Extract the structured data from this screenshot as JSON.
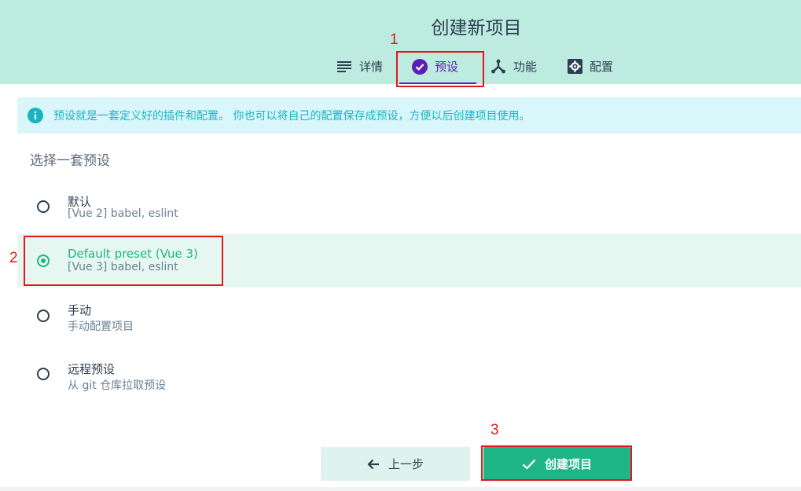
{
  "header": {
    "title": "创建新项目"
  },
  "tabs": [
    {
      "label": "详情",
      "icon": "list-icon"
    },
    {
      "label": "预设",
      "icon": "check-circle-icon",
      "active": true
    },
    {
      "label": "功能",
      "icon": "fork-icon"
    },
    {
      "label": "配置",
      "icon": "gear-icon"
    }
  ],
  "info": {
    "text": "预设就是一套定义好的插件和配置。 你也可以将自己的配置保存成预设，方便以后创建项目使用。",
    "icon": "info-icon"
  },
  "section_label": "选择一套预设",
  "options": [
    {
      "name": "默认",
      "desc": "[Vue 2] babel, eslint",
      "selected": false
    },
    {
      "name": "Default preset (Vue 3)",
      "desc": "[Vue 3] babel, eslint",
      "selected": true
    },
    {
      "name": "手动",
      "desc": "手动配置项目",
      "selected": false
    },
    {
      "name": "远程预设",
      "desc": "从 git 仓库拉取预设",
      "selected": false
    }
  ],
  "buttons": {
    "prev_label": "上一步",
    "create_label": "创建项目"
  },
  "annotations": [
    "1",
    "2",
    "3"
  ],
  "colors": {
    "header_bg": "#bdebdf",
    "accent_purple": "#5c1fb0",
    "accent_green": "#1fb584",
    "info_bg": "#d9f7fb",
    "info_text": "#1ab3c2",
    "annotation_red": "#e0191e"
  }
}
